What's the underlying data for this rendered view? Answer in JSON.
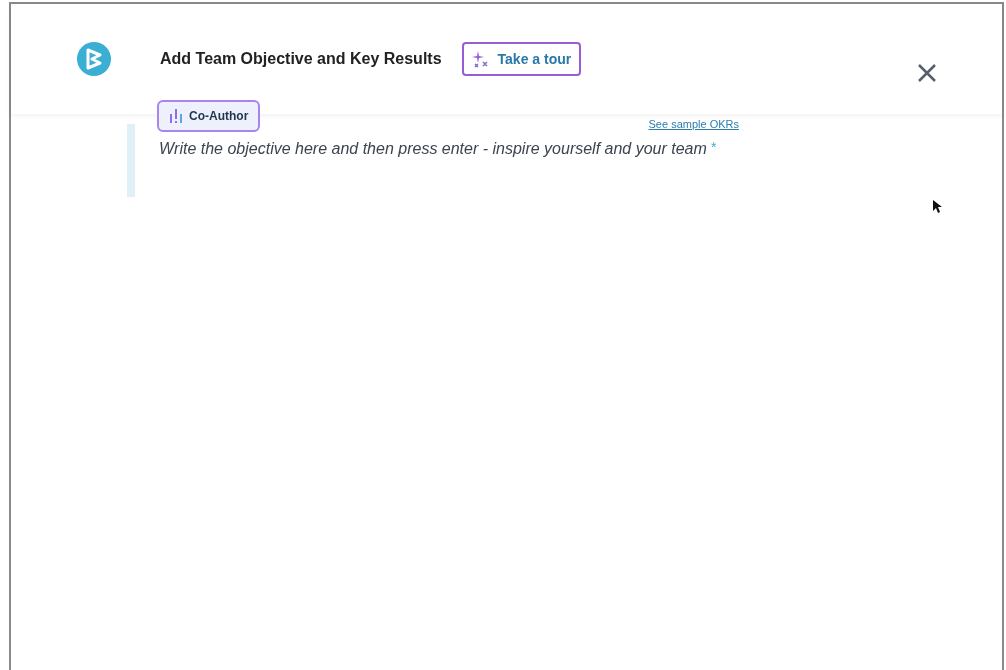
{
  "header": {
    "title": "Add Team Objective and Key Results",
    "tour_button": "Take a tour"
  },
  "co_author_button": "Co-Author",
  "sample_link": "See sample OKRs",
  "objective_field": {
    "placeholder": "Write the objective here and then press enter - inspire yourself and your team",
    "required_mark": "*"
  }
}
